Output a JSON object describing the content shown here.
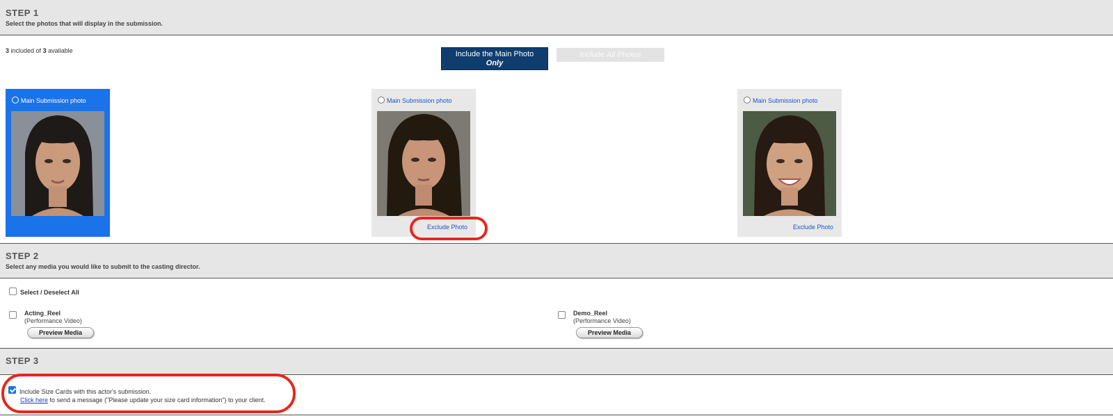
{
  "step1": {
    "title": "STEP 1",
    "subtitle": "Select the photos that will display in the submission.",
    "included": "3",
    "included_of_text": " included of ",
    "available": "3",
    "available_text": " available",
    "btn_main_line1": "Include the Main Photo",
    "btn_main_line2": "Only",
    "btn_all_pre": "Include ",
    "btn_all_em": "All",
    "btn_all_post": " Photos",
    "photos": [
      {
        "label": "Main Submission photo",
        "selected": true
      },
      {
        "label": "Main Submission photo",
        "exclude": "Exclude Photo"
      },
      {
        "label": "Main Submission photo",
        "exclude": "Exclude Photo"
      }
    ]
  },
  "step2": {
    "title": "STEP 2",
    "subtitle": "Select any media you would like to submit to the casting director.",
    "select_all": "Select / Deselect All",
    "media": [
      {
        "name": "Acting_Reel",
        "type": "(Performance Video)",
        "button": "Preview Media"
      },
      {
        "name": "Demo_Reel",
        "type": "(Performance Video)",
        "button": "Preview Media"
      }
    ]
  },
  "step3": {
    "title": "STEP 3",
    "size_cards_text": "Include Size Cards with this actor's submission.",
    "click_here": "Click here",
    "click_rest": " to send a message (\"Please update your size card information\") to your client."
  },
  "colors": {
    "accent_blue": "#1a73e8",
    "navy_button": "#0f3d6e",
    "highlight_red": "#e8261a",
    "header_gray": "#e6e6e6"
  }
}
